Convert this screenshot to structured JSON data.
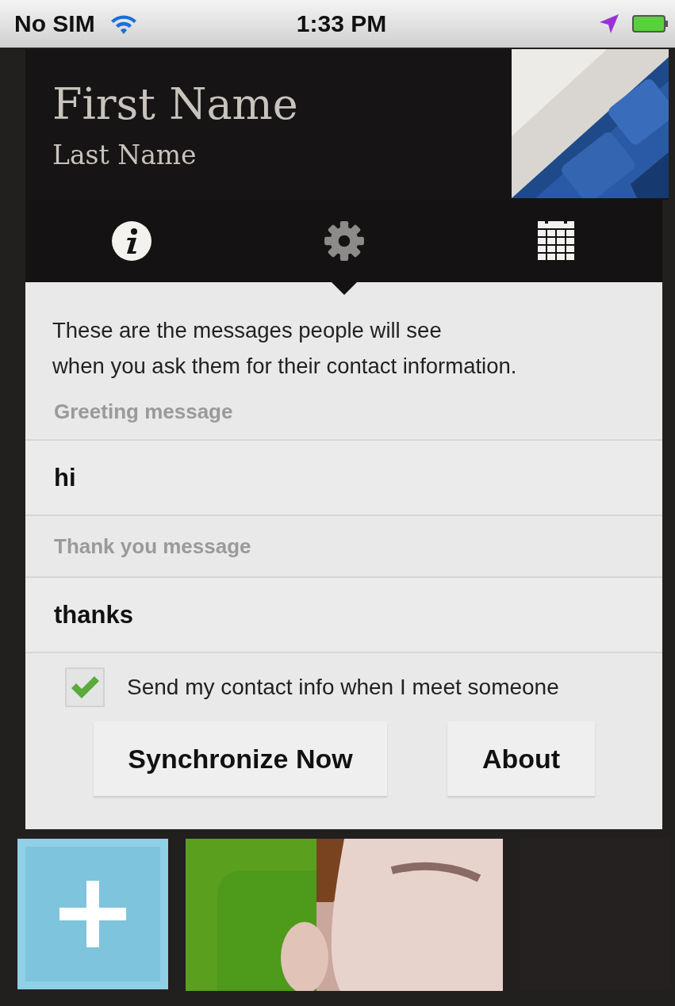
{
  "status_bar": {
    "carrier": "No SIM",
    "time": "1:33 PM"
  },
  "profile": {
    "first_name": "First Name",
    "last_name": "Last Name",
    "photo": {
      "kind": "picture"
    }
  },
  "tabs": [
    {
      "kind": "info",
      "selected": false
    },
    {
      "kind": "settings",
      "selected": true
    },
    {
      "kind": "calendar",
      "selected": false
    }
  ],
  "settings": {
    "description": "These are the messages people will see\nwhen you ask them for their contact information.",
    "fields": [
      {
        "label": "Greeting message",
        "value": "hi"
      },
      {
        "label": "Thank you message",
        "value": "thanks"
      }
    ],
    "send_contact": {
      "label": "Send my contact info when I meet someone",
      "checked": true
    },
    "buttons": [
      "Synchronize Now",
      "About"
    ]
  },
  "tiles": [
    {
      "kind": "add"
    },
    {
      "kind": "picture"
    },
    {
      "kind": "empty"
    }
  ]
}
